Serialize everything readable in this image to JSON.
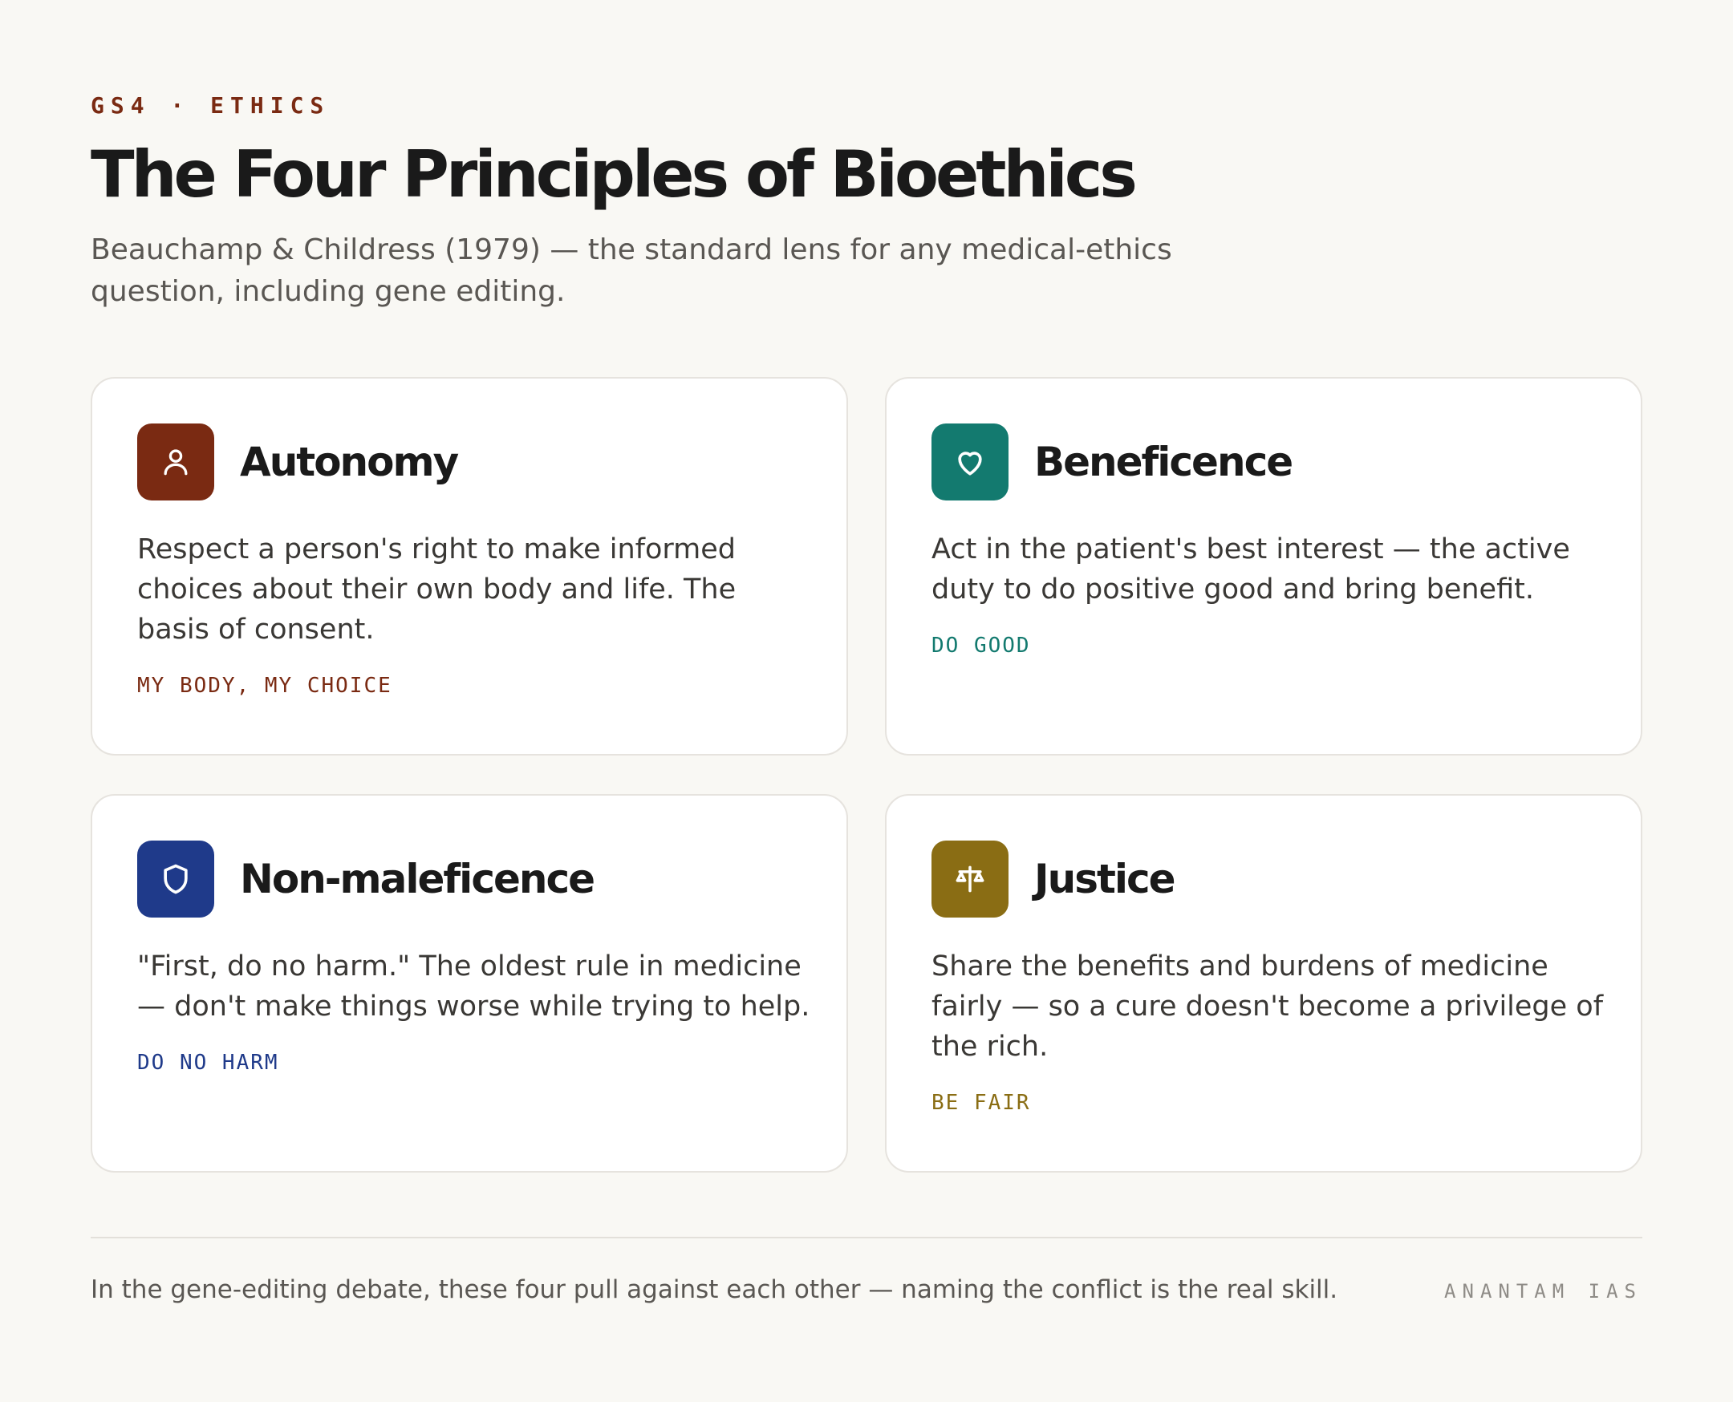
{
  "header": {
    "eyebrow": "GS4 · ETHICS",
    "title": "The Four Principles of Bioethics",
    "subtitle": "Beauchamp & Childress (1979) — the standard lens for any medical-ethics question, including gene editing."
  },
  "cards": [
    {
      "title": "Autonomy",
      "body": "Respect a person's right to make informed choices about their own body and life. The basis of consent.",
      "tag": "MY BODY, MY CHOICE",
      "icon": "person-icon",
      "color": "#7a2a12"
    },
    {
      "title": "Beneficence",
      "body": "Act in the patient's best interest — the active duty to do positive good and bring benefit.",
      "tag": "DO GOOD",
      "icon": "heart-icon",
      "color": "#137a6f"
    },
    {
      "title": "Non-maleficence",
      "body": "\"First, do no harm.\" The oldest rule in medicine — don't make things worse while trying to help.",
      "tag": "DO NO HARM",
      "icon": "shield-icon",
      "color": "#1f3a8a"
    },
    {
      "title": "Justice",
      "body": "Share the benefits and burdens of medicine fairly — so a cure doesn't become a privilege of the rich.",
      "tag": "BE FAIR",
      "icon": "scales-icon",
      "color": "#8a6d14"
    }
  ],
  "footer": {
    "note": "In the gene-editing debate, these four pull against each other — naming the conflict is the real skill.",
    "brand": "ANANTAM IAS"
  }
}
